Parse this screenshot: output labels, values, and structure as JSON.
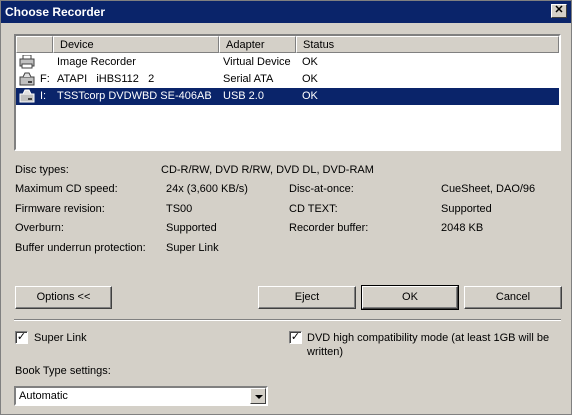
{
  "window": {
    "title": "Choose Recorder",
    "close_glyph": "✕"
  },
  "devices": {
    "columns": [
      "Device",
      "Adapter",
      "Status"
    ],
    "rows": [
      {
        "letter": "",
        "device": "Image Recorder",
        "adapter": "Virtual Device",
        "status": "OK",
        "icon": "printer-icon",
        "selected": false
      },
      {
        "letter": "F:",
        "device": "ATAPI   iHBS112   2",
        "adapter": "Serial ATA",
        "status": "OK",
        "icon": "drive-icon",
        "selected": false
      },
      {
        "letter": "I:",
        "device": "TSSTcorp DVDWBD SE-406AB",
        "adapter": "USB 2.0",
        "status": "OK",
        "icon": "drive-icon",
        "selected": true
      }
    ]
  },
  "info": {
    "disc_types_label": "Disc types:",
    "disc_types_value": "CD-R/RW, DVD R/RW, DVD DL, DVD-RAM",
    "max_cd_speed_label": "Maximum CD speed:",
    "max_cd_speed_value": "24x (3,600 KB/s)",
    "disc_at_once_label": "Disc-at-once:",
    "disc_at_once_value": "CueSheet, DAO/96",
    "firmware_label": "Firmware revision:",
    "firmware_value": "TS00",
    "cd_text_label": "CD TEXT:",
    "cd_text_value": "Supported",
    "overburn_label": "Overburn:",
    "overburn_value": "Supported",
    "recorder_buffer_label": "Recorder buffer:",
    "recorder_buffer_value": "2048 KB",
    "buffer_underrun_label": "Buffer underrun protection:",
    "buffer_underrun_value": "Super Link"
  },
  "buttons": {
    "options": "Options <<",
    "eject": "Eject",
    "ok": "OK",
    "cancel": "Cancel"
  },
  "options": {
    "super_link_label": "Super Link",
    "super_link_checked": true,
    "dvd_compat_label_line1": "DVD high compatibility mode (at least 1GB will be",
    "dvd_compat_label_line2": "written)",
    "dvd_compat_checked": true,
    "check_glyph": "✓",
    "book_type_label": "Book Type settings:",
    "book_type_value": "Automatic"
  }
}
